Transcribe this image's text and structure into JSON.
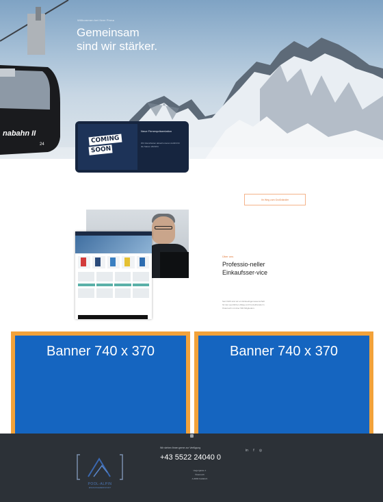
{
  "hero": {
    "kicker": "Willkommen bei Ihrer Firma",
    "title_line1": "Gemeinsam",
    "title_line2": "sind wir stärker.",
    "gondola_text": "nabahn II",
    "gondola_number": "24"
  },
  "coming_soon": {
    "badge_top": "",
    "badge_line1": "COMING",
    "badge_line2": "SOON",
    "title": "Neue Firmenpräsentation",
    "text": "Wir überarbeiten aktuell unseren Auftritt für die Saison 2023/24"
  },
  "middle": {
    "button_label": "Ihr Weg zum Großhändler",
    "service_kicker": "Über uns",
    "service_title": "Professio-neller Einkaufsser-vice",
    "service_text": "Seit 1920 sind wir ein Einkaufsgenossenschaft für den sportlichen Alltag und Freizeithandel in Österreich mit über 500 Mitgliedern."
  },
  "banners": [
    {
      "label": "Banner 740 x 370"
    },
    {
      "label": "Banner 740 x 370"
    }
  ],
  "footer": {
    "hotline_label": "Wir stehen Ihnen gerne zur Verfügung",
    "phone": "+43 5522 24040 0",
    "address_line1": "Hegergasse 1",
    "address_line2": "Österreich",
    "address_line3": "A-6800 Feldkirch",
    "logo_name": "POOL-ALPIN",
    "logo_sub": "EINKAUFSGEMEINSCHAFT",
    "social_icons": [
      "linkedin-icon",
      "facebook-icon",
      "instagram-icon"
    ],
    "social_glyphs": [
      "in",
      "f",
      "◎"
    ]
  },
  "colors": {
    "banner_blue": "#1565c0",
    "banner_border": "#f2a23a",
    "footer_bg": "#2c3137",
    "accent_orange": "#e27a3a",
    "card_navy": "#16253f"
  }
}
